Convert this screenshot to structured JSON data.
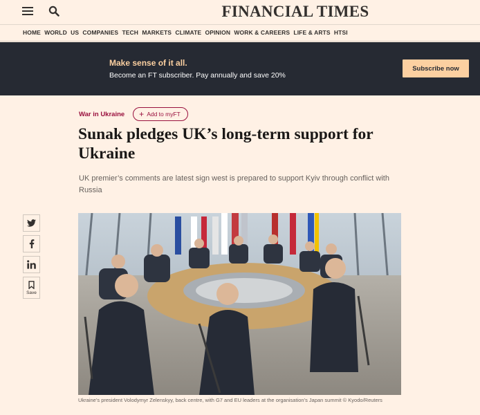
{
  "header": {
    "masthead": "FINANCIAL TIMES",
    "menu_icon": "hamburger-menu-icon",
    "search_icon": "search-icon"
  },
  "nav": {
    "items": [
      "HOME",
      "WORLD",
      "US",
      "COMPANIES",
      "TECH",
      "MARKETS",
      "CLIMATE",
      "OPINION",
      "WORK & CAREERS",
      "LIFE & ARTS",
      "HTSI"
    ]
  },
  "promo": {
    "headline": "Make sense of it all.",
    "subline": "Become an FT subscriber. Pay annually and save 20%",
    "button_label": "Subscribe now",
    "colors": {
      "background": "#262a33",
      "accent": "#fcd0a1"
    }
  },
  "article": {
    "topic": "War in Ukraine",
    "myft_label": "Add to myFT",
    "headline": "Sunak pledges UK’s long-term support for Ukraine",
    "standfirst": "UK premier’s comments are latest sign west is prepared to support Kyiv through conflict with Russia",
    "caption": "Ukraine’s president Volodymyr Zelenskyy, back centre, with G7 and EU leaders at the organisation’s Japan summit © Kyodo/Reuters",
    "brand_color": "#990f3d"
  },
  "share": {
    "twitter_icon": "twitter-icon",
    "facebook_icon": "facebook-icon",
    "linkedin_icon": "linkedin-icon",
    "save_icon": "bookmark-icon",
    "save_label": "Save"
  }
}
